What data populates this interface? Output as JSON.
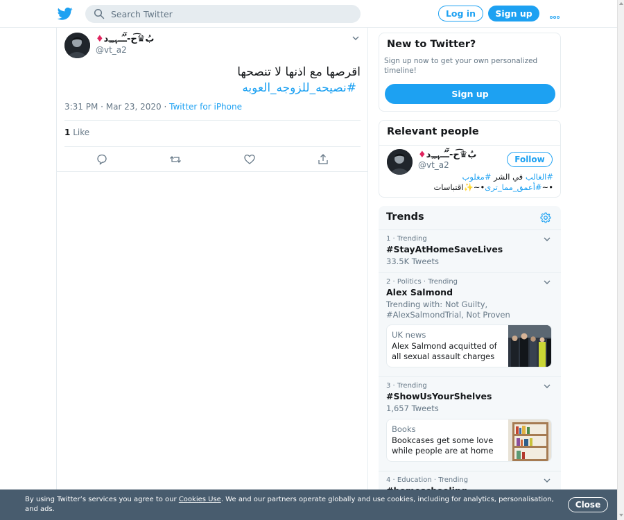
{
  "header": {
    "search_placeholder": "Search Twitter",
    "login_label": "Log in",
    "signup_label": "Sign up"
  },
  "tweet": {
    "author_name": "بُ♛͡ح-ـُٓـ‌ُـ‌ﮩـِـ‌ِد",
    "author_handle": "@vt_a2",
    "text": "اقرصها مع اذنها لا تنصحها",
    "hashtag": "#نصيحه_للزوجه_العوبه",
    "time": "3:31 PM · Mar 23, 2020 · ",
    "source": "Twitter for iPhone",
    "like_count": "1",
    "like_label": "Like"
  },
  "new_to_twitter": {
    "title": "New to Twitter?",
    "description": "Sign up now to get your own personalized timeline!",
    "signup_label": "Sign up"
  },
  "relevant_people": {
    "title": "Relevant people",
    "name": "بُ♛͡ح-ـُٓـ‌ُـ‌ﮩـِـ‌ِد",
    "handle": "@vt_a2",
    "follow_label": "Follow",
    "bio_part1_link": "#الغالب",
    "bio_part1_text": " في الشر ",
    "bio_part1_link2": "#مغلوب",
    "bio_part2_prefix": "•~",
    "bio_part2_link": "#أعمق_مما_ترى",
    "bio_part2_suffix": "•~✨اقتباسات"
  },
  "trends": {
    "title": "Trends",
    "items": [
      {
        "meta": "1 · Trending",
        "name": "#StayAtHomeSaveLives",
        "sub": "33.5K Tweets"
      },
      {
        "meta": "2 · Politics · Trending",
        "name": "Alex Salmond",
        "sub": "Trending with: Not Guilty, #AlexSalmondTrial, Not Proven",
        "news_category": "UK news",
        "news_headline": "Alex Salmond acquitted of all sexual assault charges"
      },
      {
        "meta": "3 · Trending",
        "name": "#ShowUsYourShelves",
        "sub": "1,657 Tweets",
        "news_category": "Books",
        "news_headline": "Bookcases get some love while people are at home …"
      },
      {
        "meta": "4 · Education · Trending",
        "name": "#homeschooling",
        "sub": ""
      }
    ]
  },
  "cookie_banner": {
    "text_before": "By using Twitter’s services you agree to our ",
    "link": "Cookies Use",
    "text_after": ". We and our partners operate globally and use cookies, including for analytics, personalisation, and ads.",
    "close_label": "Close"
  },
  "colors": {
    "accent": "#1da1f2",
    "text": "#14171a",
    "muted": "#657786",
    "border": "#e6ecf0",
    "banner": "#485c6e",
    "diamond": "#e0245e"
  }
}
